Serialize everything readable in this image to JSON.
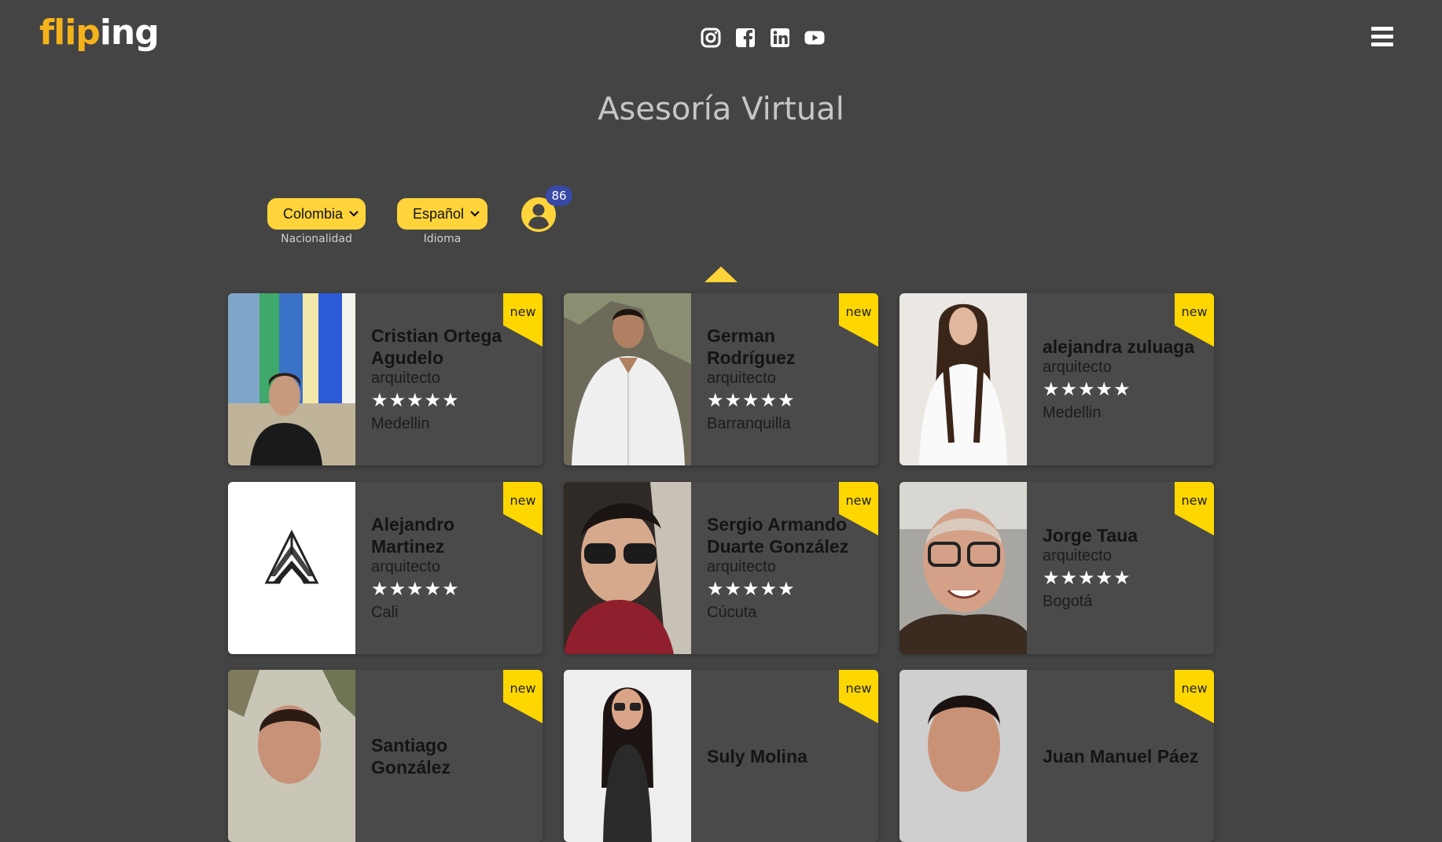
{
  "header": {
    "logo": {
      "part1": "flip",
      "part2": "ing"
    },
    "social": [
      {
        "name": "instagram-icon"
      },
      {
        "name": "facebook-icon"
      },
      {
        "name": "linkedin-icon"
      },
      {
        "name": "youtube-icon"
      }
    ]
  },
  "title": "Asesoría Virtual",
  "filters": {
    "nationality": {
      "value": "Colombia",
      "caption": "Nacionalidad"
    },
    "language": {
      "value": "Español",
      "caption": "Idioma"
    }
  },
  "user_count": "86",
  "colors": {
    "accent": "#ffd43b",
    "badge": "#3849a8",
    "background": "#444444"
  },
  "cards": [
    {
      "name": "Cristian Ortega Agudelo",
      "profession": "arquitecto",
      "stars": "★★★★★",
      "city": "Medellin",
      "badge": "new",
      "photo": "photo-stained-glass"
    },
    {
      "name": "German Rodríguez",
      "profession": "arquitecto",
      "stars": "★★★★★",
      "city": "Barranquilla",
      "badge": "new",
      "photo": "photo-white-shirt"
    },
    {
      "name": "alejandra zuluaga",
      "profession": "arquitecto",
      "stars": "★★★★★",
      "city": "Medellin",
      "badge": "new",
      "photo": "photo-woman"
    },
    {
      "name": "Alejandro Martinez",
      "profession": "arquitecto",
      "stars": "★★★★★",
      "city": "Cali",
      "badge": "new",
      "photo": "logo-alejandro-martinez"
    },
    {
      "name": "Sergio Armando Duarte González",
      "profession": "arquitecto",
      "stars": "★★★★★",
      "city": "Cúcuta",
      "badge": "new",
      "photo": "photo-sunglasses"
    },
    {
      "name": "Jorge Taua",
      "profession": "arquitecto",
      "stars": "★★★★★",
      "city": "Bogotá",
      "badge": "new",
      "photo": "photo-glasses"
    },
    {
      "name": "Santiago González",
      "profession": "",
      "stars": "",
      "city": "",
      "badge": "new",
      "photo": "photo-outdoor"
    },
    {
      "name": "Suly Molina",
      "profession": "",
      "stars": "",
      "city": "",
      "badge": "new",
      "photo": "photo-woman-2"
    },
    {
      "name": "Juan Manuel Páez",
      "profession": "",
      "stars": "",
      "city": "",
      "badge": "new",
      "photo": "photo-man"
    }
  ]
}
